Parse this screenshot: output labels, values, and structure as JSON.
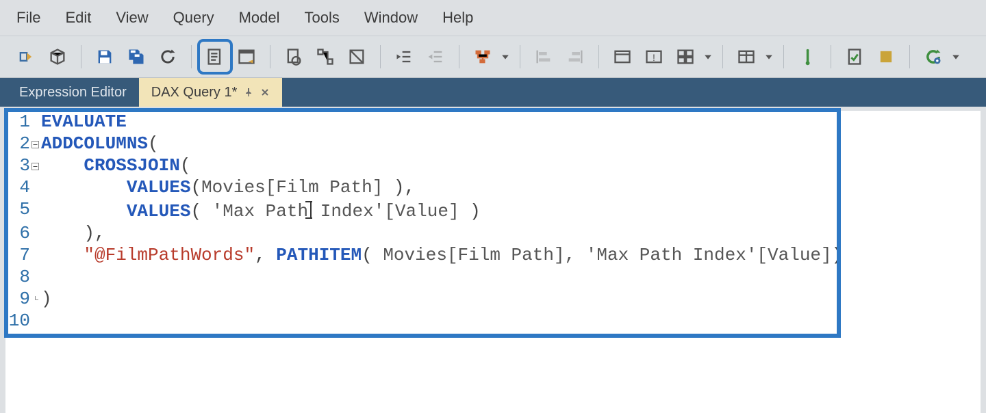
{
  "menu": {
    "items": [
      "File",
      "Edit",
      "View",
      "Query",
      "Model",
      "Tools",
      "Window",
      "Help"
    ]
  },
  "toolbar": {
    "icons": [
      "connect-icon",
      "deploy-icon",
      "save-icon",
      "save-all-icon",
      "refresh-icon",
      "new-query-icon",
      "format-code-icon",
      "script-icon",
      "diagram-icon",
      "properties-icon",
      "indent-icon",
      "outdent-icon",
      "relationship-icon",
      "relationship-dropdown",
      "align-left-icon",
      "align-right-icon",
      "window-icon",
      "warning-window-icon",
      "manage-icon",
      "manage-dropdown",
      "table-icon",
      "table-dropdown",
      "run-icon",
      "doc-check-icon",
      "stop-icon",
      "execute-icon",
      "execute-dropdown"
    ]
  },
  "tabs": {
    "inactive": {
      "label": "Expression Editor"
    },
    "active": {
      "label": "DAX Query 1*"
    }
  },
  "code": {
    "lines": [
      {
        "num": "1",
        "tokens": [
          {
            "t": "kw",
            "v": "EVALUATE"
          }
        ]
      },
      {
        "num": "2",
        "fold": "minus",
        "tokens": [
          {
            "t": "func",
            "v": "ADDCOLUMNS"
          },
          {
            "t": "punc",
            "v": "("
          }
        ]
      },
      {
        "num": "3",
        "fold": "minus",
        "tokens": [
          {
            "t": "pad",
            "v": "    "
          },
          {
            "t": "func",
            "v": "CROSSJOIN"
          },
          {
            "t": "punc",
            "v": "("
          }
        ]
      },
      {
        "num": "4",
        "tokens": [
          {
            "t": "pad",
            "v": "        "
          },
          {
            "t": "func",
            "v": "VALUES"
          },
          {
            "t": "punc",
            "v": "("
          },
          {
            "t": "ident",
            "v": "Movies[Film Path] "
          },
          {
            "t": "punc",
            "v": "),"
          }
        ]
      },
      {
        "num": "5",
        "tokens": [
          {
            "t": "pad",
            "v": "        "
          },
          {
            "t": "func",
            "v": "VALUES"
          },
          {
            "t": "punc",
            "v": "( "
          },
          {
            "t": "ident",
            "v": "'Max Path"
          },
          {
            "t": "cursor",
            "v": ""
          },
          {
            "t": "ident",
            "v": " Index'[Value] "
          },
          {
            "t": "punc",
            "v": ")"
          }
        ]
      },
      {
        "num": "6",
        "tokens": [
          {
            "t": "pad",
            "v": "    "
          },
          {
            "t": "punc",
            "v": "),"
          }
        ]
      },
      {
        "num": "7",
        "tokens": [
          {
            "t": "pad",
            "v": "    "
          },
          {
            "t": "str",
            "v": "\"@FilmPathWords\""
          },
          {
            "t": "punc",
            "v": ", "
          },
          {
            "t": "func",
            "v": "PATHITEM"
          },
          {
            "t": "punc",
            "v": "( "
          },
          {
            "t": "ident",
            "v": "Movies[Film Path], 'Max Path Index'[Value]"
          },
          {
            "t": "punc",
            "v": ")"
          }
        ]
      },
      {
        "num": "8",
        "tokens": []
      },
      {
        "num": "9",
        "fold": "end",
        "tokens": [
          {
            "t": "punc",
            "v": ")"
          }
        ]
      },
      {
        "num": "10",
        "tokens": []
      }
    ]
  }
}
